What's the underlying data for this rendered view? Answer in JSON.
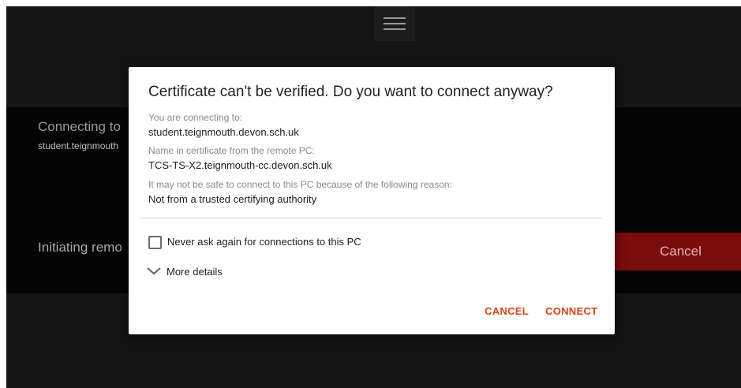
{
  "background": {
    "connecting_title": "Connecting to",
    "connecting_host": "student.teignmouth",
    "status_text": "Initiating remo",
    "cancel_label": "Cancel",
    "menu_icon": "hamburger-menu-icon"
  },
  "dialog": {
    "title": "Certificate can't be verified. Do you want to connect anyway?",
    "connecting_to_label": "You are connecting to:",
    "connecting_to_value": "student.teignmouth.devon.sch.uk",
    "cert_name_label": "Name in certificate from the remote PC:",
    "cert_name_value": "TCS-TS-X2.teignmouth-cc.devon.sch.uk",
    "reason_label": "It may not be safe to connect to this PC because of the following reason:",
    "reason_value": "Not from a trusted certifying authority",
    "never_ask_label": "Never ask again for connections to this PC",
    "never_ask_checked": false,
    "more_details_label": "More details",
    "cancel_button": "CANCEL",
    "connect_button": "CONNECT"
  },
  "colors": {
    "accent": "#d84315",
    "background_dark": "#141414",
    "cancel_red": "#7a0c0c"
  }
}
